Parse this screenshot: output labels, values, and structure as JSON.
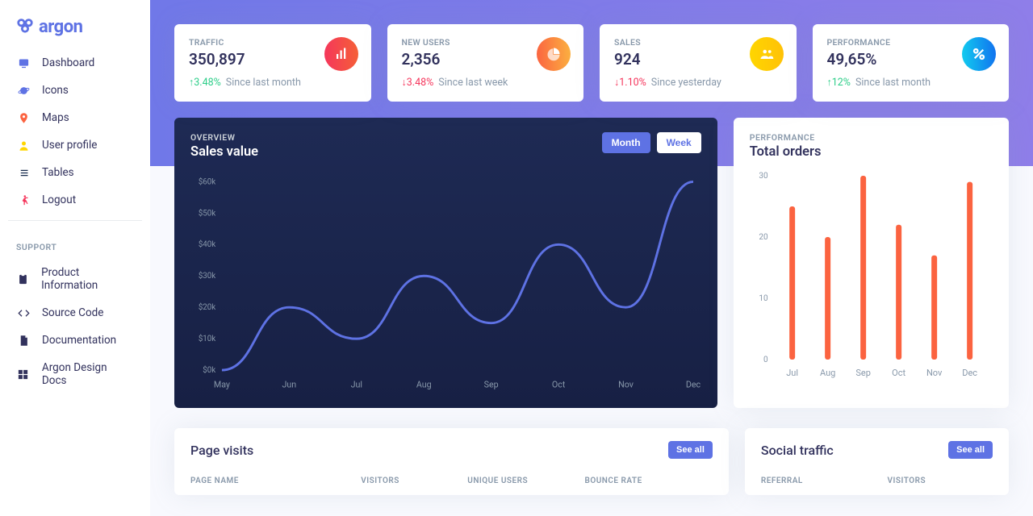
{
  "brand": {
    "name": "argon"
  },
  "nav": {
    "items": [
      {
        "label": "Dashboard",
        "icon": "tv",
        "color": "#5e72e4"
      },
      {
        "label": "Icons",
        "icon": "planet",
        "color": "#5e72e4"
      },
      {
        "label": "Maps",
        "icon": "pin",
        "color": "#fb6340"
      },
      {
        "label": "User profile",
        "icon": "user",
        "color": "#ffd600"
      },
      {
        "label": "Tables",
        "icon": "list",
        "color": "#8898aa"
      },
      {
        "label": "Logout",
        "icon": "run",
        "color": "#f5365c"
      }
    ],
    "support_header": "SUPPORT",
    "support": [
      {
        "label": "Product Information"
      },
      {
        "label": "Source Code"
      },
      {
        "label": "Documentation"
      },
      {
        "label": "Argon Design Docs"
      }
    ]
  },
  "stats": [
    {
      "label": "TRAFFIC",
      "value": "350,897",
      "change": "3.48%",
      "dir": "up",
      "since": "Since last month"
    },
    {
      "label": "NEW USERS",
      "value": "2,356",
      "change": "3.48%",
      "dir": "down",
      "since": "Since last week"
    },
    {
      "label": "SALES",
      "value": "924",
      "change": "1.10%",
      "dir": "down",
      "since": "Since yesterday"
    },
    {
      "label": "PERFORMANCE",
      "value": "49,65%",
      "change": "12%",
      "dir": "up",
      "since": "Since last month"
    }
  ],
  "sales_chart": {
    "overline": "OVERVIEW",
    "title": "Sales value",
    "buttons": {
      "month": "Month",
      "week": "Week"
    }
  },
  "orders_chart": {
    "overline": "PERFORMANCE",
    "title": "Total orders"
  },
  "page_visits": {
    "title": "Page visits",
    "see_all": "See all",
    "columns": [
      "PAGE NAME",
      "VISITORS",
      "UNIQUE USERS",
      "BOUNCE RATE"
    ]
  },
  "social_traffic": {
    "title": "Social traffic",
    "see_all": "See all",
    "columns": [
      "REFERRAL",
      "VISITORS"
    ]
  },
  "chart_data": [
    {
      "type": "line",
      "title": "Sales value",
      "xlabel": "",
      "ylabel": "",
      "ylim": [
        0,
        60
      ],
      "ytick_suffix": "k",
      "ytick_prefix": "$",
      "categories": [
        "May",
        "Jun",
        "Jul",
        "Aug",
        "Sep",
        "Oct",
        "Nov",
        "Dec"
      ],
      "values": [
        0,
        20,
        10,
        30,
        15,
        40,
        20,
        60
      ]
    },
    {
      "type": "bar",
      "title": "Total orders",
      "xlabel": "",
      "ylabel": "",
      "ylim": [
        0,
        30
      ],
      "categories": [
        "Jul",
        "Aug",
        "Sep",
        "Oct",
        "Nov",
        "Dec"
      ],
      "values": [
        25,
        20,
        30,
        22,
        17,
        29
      ]
    }
  ]
}
